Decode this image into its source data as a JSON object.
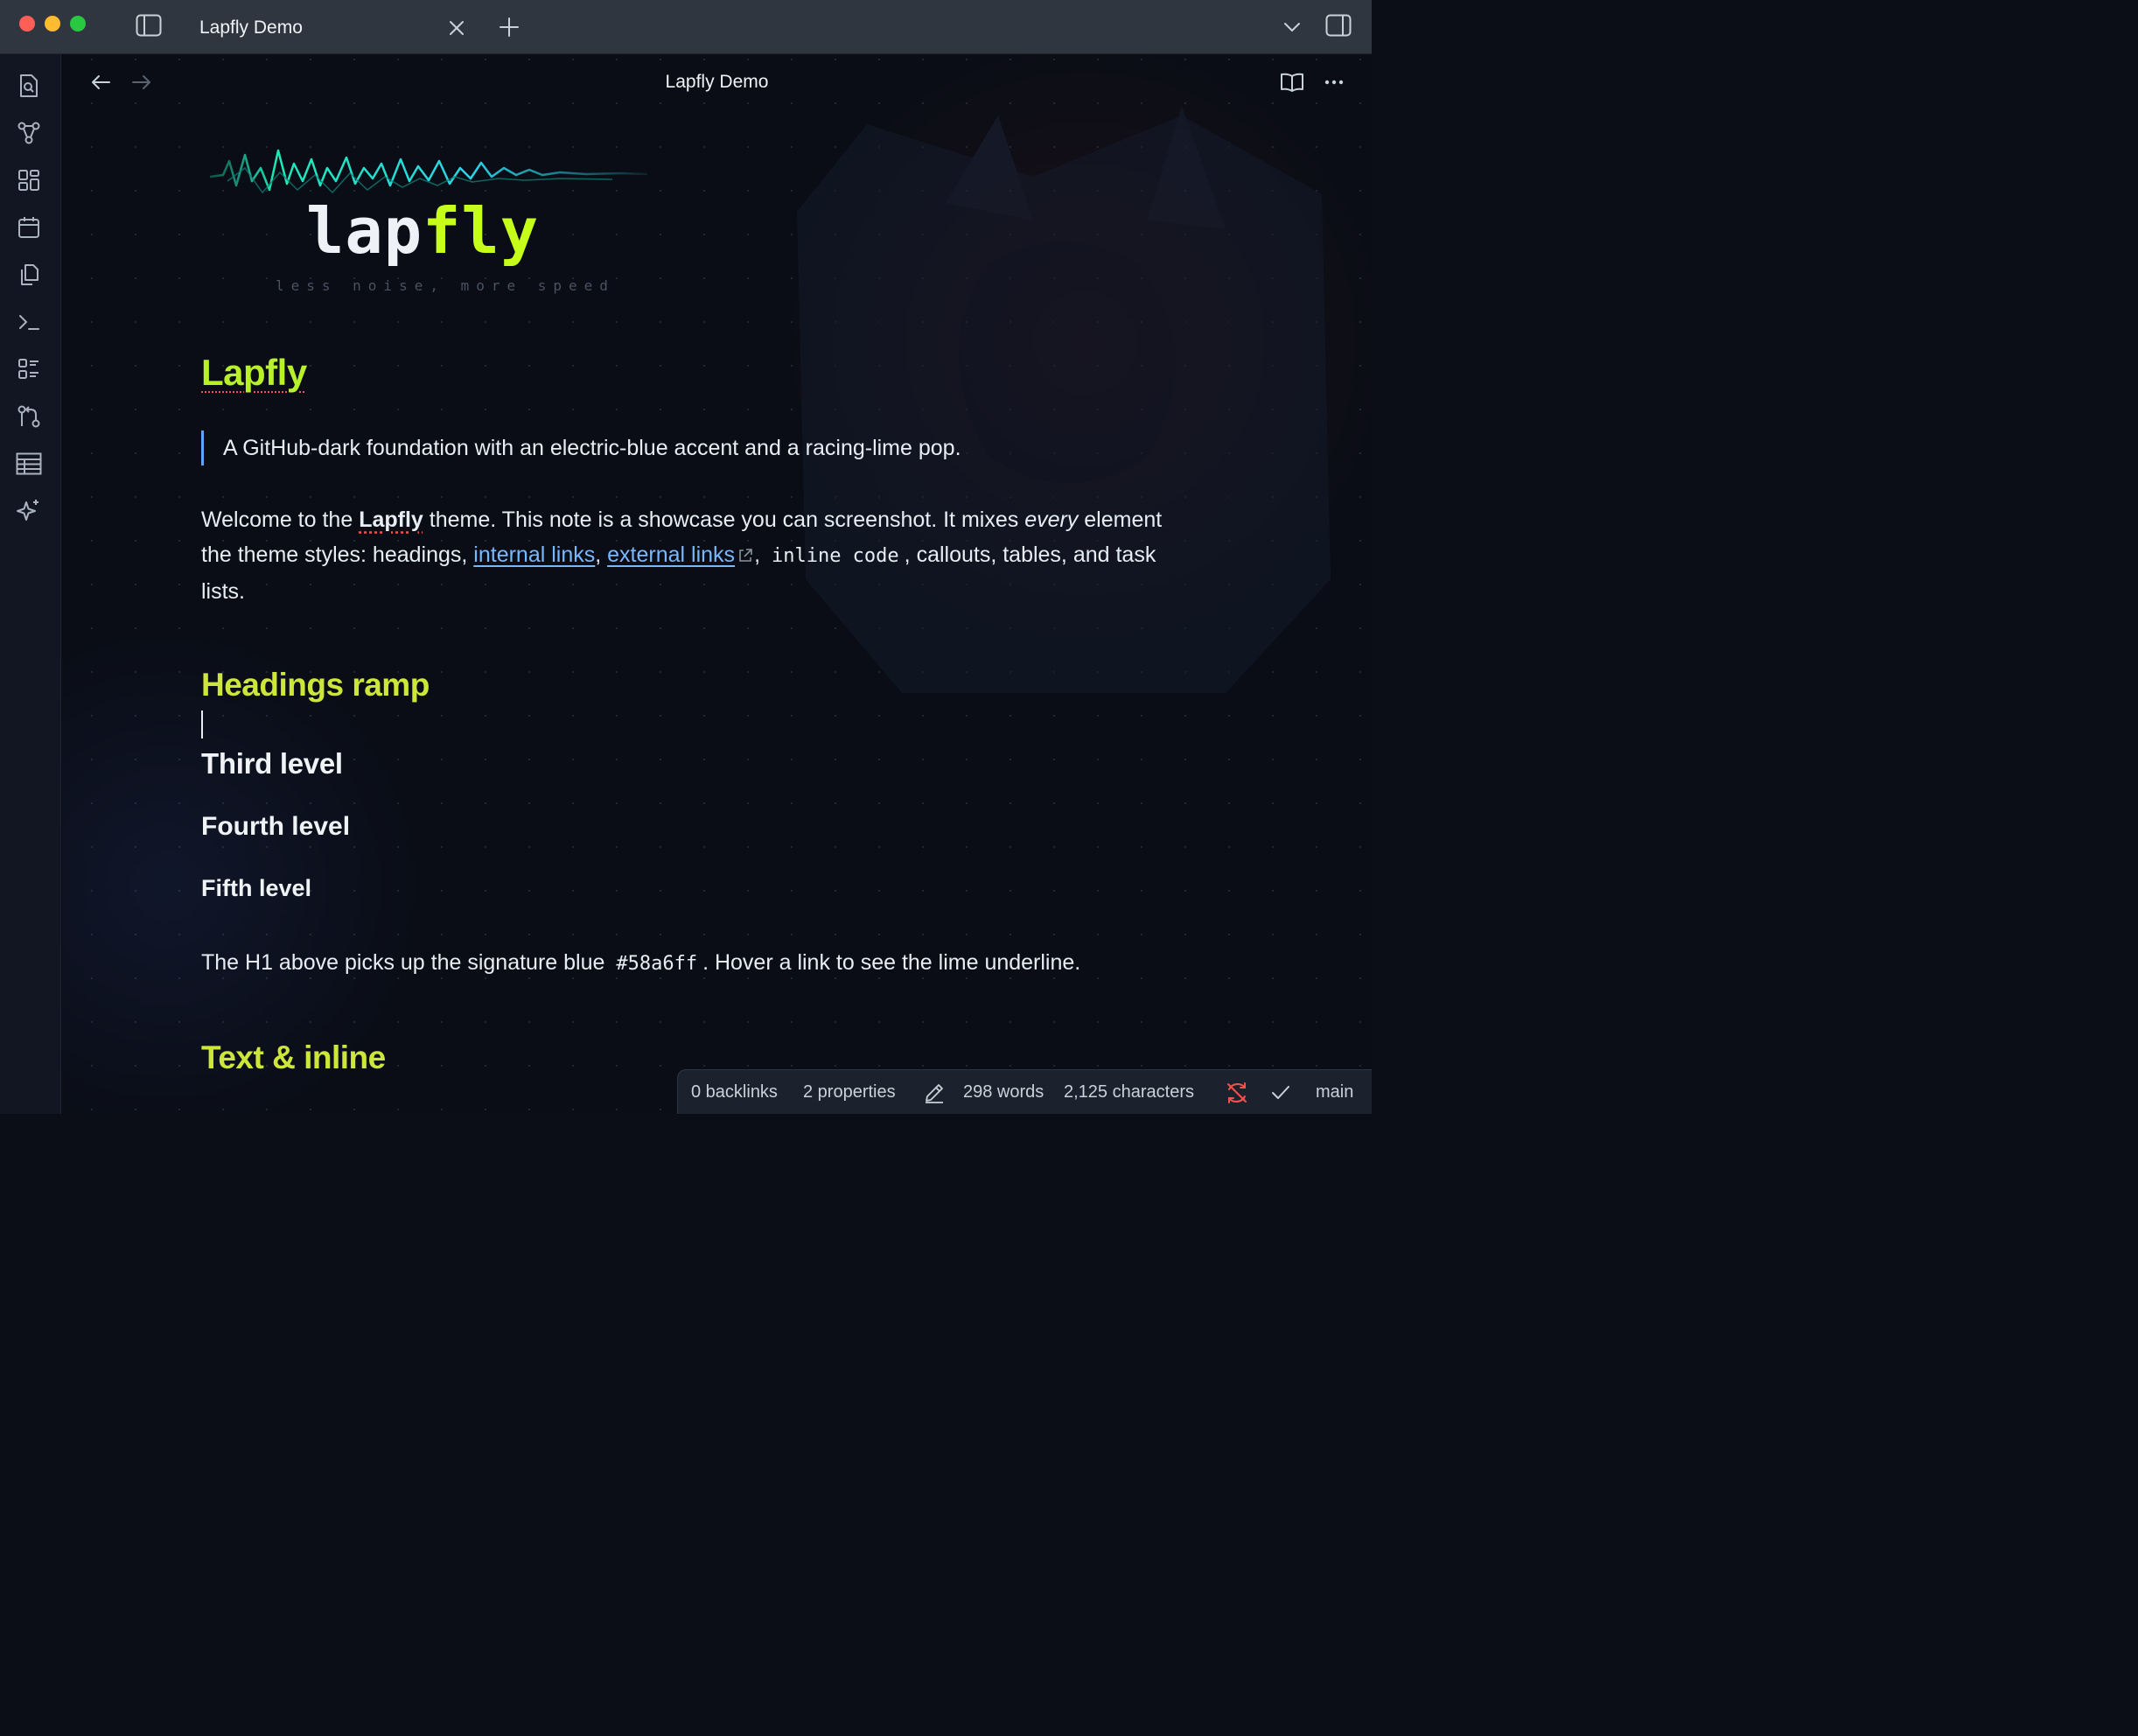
{
  "window": {
    "tab_title": "Lapfly Demo"
  },
  "view": {
    "title": "Lapfly Demo"
  },
  "logo": {
    "word_white": "lap",
    "word_lime": "fly",
    "tagline": "less noise, more speed"
  },
  "document": {
    "h1": "Lapfly",
    "quote": "A GitHub-dark foundation with an electric-blue accent and a racing-lime pop.",
    "intro": {
      "p1": "Welcome to the ",
      "bold": "Lapfly",
      "p2": " theme. This note is a showcase you can screenshot. It mixes ",
      "italic": "every",
      "p3": " element the theme styles: headings, ",
      "internal_link": "internal links",
      "sep1": ", ",
      "external_link": "external links",
      "sep2": ", ",
      "inline_code": "inline code",
      "p4": ", callouts, tables, and task lists."
    },
    "h2_headings": "Headings ramp",
    "h3": "Third level",
    "h4": "Fourth level",
    "h5": "Fifth level",
    "h1_line": {
      "p1": "The H1 above picks up the signature blue ",
      "code": "#58a6ff",
      "p2": ". Hover a link to see the lime underline."
    },
    "h2_text": "Text & inline"
  },
  "status_bar": {
    "backlinks": "0 backlinks",
    "properties": "2 properties",
    "words": "298 words",
    "characters": "2,125 characters",
    "branch": "main"
  },
  "icons": {
    "ribbon": [
      "file-search-icon",
      "graph-icon",
      "layout-grid-icon",
      "calendar-icon",
      "copy-icon",
      "terminal-icon",
      "list-checks-icon",
      "git-compare-icon",
      "table-icon",
      "sparkles-icon"
    ]
  },
  "colors": {
    "accent_blue": "#58a6ff",
    "lime": "#c6ff1a",
    "background": "#0a0d16",
    "sync_error": "#f85149"
  }
}
